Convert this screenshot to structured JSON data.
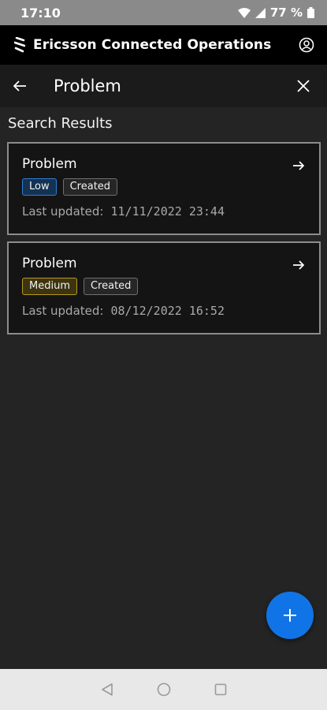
{
  "status_bar": {
    "time": "17:10",
    "battery": "77 %"
  },
  "app_header": {
    "title": "Ericsson Connected Operations"
  },
  "toolbar": {
    "title": "Problem"
  },
  "section": {
    "title": "Search Results"
  },
  "results": [
    {
      "title": "Problem",
      "severity": "Low",
      "state": "Created",
      "updated_label": "Last updated:",
      "updated_value": "11/11/2022 23:44"
    },
    {
      "title": "Problem",
      "severity": "Medium",
      "state": "Created",
      "updated_label": "Last updated:",
      "updated_value": "08/12/2022 16:52"
    }
  ],
  "colors": {
    "accent": "#1174e6",
    "low": "#2e7dd1",
    "medium": "#b8981f"
  },
  "icons": [
    "ericsson-logo-icon",
    "profile-icon",
    "back-arrow-icon",
    "close-icon",
    "arrow-right-icon",
    "plus-icon",
    "nav-back-icon",
    "nav-home-icon",
    "nav-recents-icon",
    "wifi-icon",
    "signal-icon",
    "battery-icon"
  ]
}
